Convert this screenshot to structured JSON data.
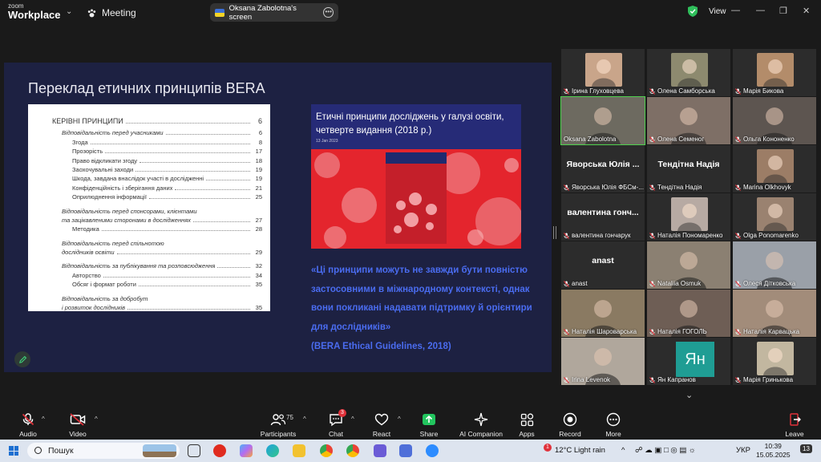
{
  "app": {
    "brand_top": "zoom",
    "brand_main": "Workplace",
    "meeting_label": "Meeting",
    "screen_label": "Oksana Zabolotna's screen",
    "view_label": "View",
    "colors": {
      "background": "#1a1a1a",
      "secure": "#2fbf5b",
      "active_speaker": "#4fd14f",
      "muted": "#e0313a"
    }
  },
  "slide": {
    "title": "Переклад етичних принципів BERA",
    "book_title_line1": "Етичні принципи досліджень у галузі освіти,",
    "book_title_line2": "четверте видання (2018 р.)",
    "book_date": "13 Jan 2023",
    "quote_lines": [
      "«Ці принципи можуть не завжди бути повністю",
      "застосовними в міжнародному контексті, однак",
      "вони покликані надавати підтримку й орієнтири",
      "для дослідників»",
      "(BERA Ethical Guidelines, 2018)"
    ],
    "toc": [
      {
        "text": "КЕРІВНІ ПРИНЦИПИ",
        "page": "6",
        "style": "h1"
      },
      {
        "text": "Відповідальність перед учасниками",
        "page": "6",
        "style": "it ind1"
      },
      {
        "text": "Згода",
        "page": "8",
        "style": "ind2"
      },
      {
        "text": "Прозорість",
        "page": "17",
        "style": "ind2"
      },
      {
        "text": "Право відкликати згоду",
        "page": "18",
        "style": "ind2"
      },
      {
        "text": "Заохочувальні заходи",
        "page": "19",
        "style": "ind2"
      },
      {
        "text": "Шкода, завдана внаслідок участі в дослідженні",
        "page": "19",
        "style": "ind2"
      },
      {
        "text": "Конфіденційність і зберігання даних",
        "page": "21",
        "style": "ind2"
      },
      {
        "text": "Оприлюднення інформації",
        "page": "25",
        "style": "ind2"
      },
      {
        "text": "Відповідальність перед спонсорами, клієнтами",
        "page": "",
        "style": "it ind1 gap nolead"
      },
      {
        "text": "та зацікавленими сторонами в дослідженнях",
        "page": "27",
        "style": "it ind1"
      },
      {
        "text": "Методика",
        "page": "28",
        "style": "ind2"
      },
      {
        "text": "Відповідальність перед спільнотою",
        "page": "",
        "style": "it ind1 gap nolead"
      },
      {
        "text": "дослідників освіти",
        "page": "29",
        "style": "it ind1"
      },
      {
        "text": "Відповідальність за публікування та розповсюдження",
        "page": "32",
        "style": "it ind1 gap"
      },
      {
        "text": "Авторство",
        "page": "34",
        "style": "ind2"
      },
      {
        "text": "Обсяг і формат роботи",
        "page": "35",
        "style": "ind2"
      },
      {
        "text": "Відповідальність за добробут",
        "page": "",
        "style": "it ind1 gap nolead"
      },
      {
        "text": "і розвиток дослідників",
        "page": "35",
        "style": "it ind1"
      }
    ]
  },
  "participants": [
    {
      "name": "Ірина Глуховцева",
      "big": "",
      "kind": "photo",
      "tone": "#c9a58a",
      "muted": true
    },
    {
      "name": "Олена Самборська",
      "big": "",
      "kind": "photo",
      "tone": "#8d8a6f",
      "muted": true
    },
    {
      "name": "Марія Бикова",
      "big": "",
      "kind": "photo",
      "tone": "#b38c6a",
      "muted": true
    },
    {
      "name": "Oksana Zabolotna",
      "big": "",
      "kind": "video",
      "tone": "#6d6a60",
      "muted": false,
      "active": true
    },
    {
      "name": "Олена Семеног",
      "big": "",
      "kind": "video",
      "tone": "#7e6f66",
      "muted": true
    },
    {
      "name": "Ольга Кононенко",
      "big": "",
      "kind": "video",
      "tone": "#5d5550",
      "muted": true
    },
    {
      "name": "Яворська Юлія ФБСм-...",
      "big": "Яворська Юлія ...",
      "kind": "text",
      "tone": "#2c2c2c",
      "muted": true
    },
    {
      "name": "Тендітна Надія",
      "big": "Тендітна Надія",
      "kind": "text",
      "tone": "#2c2c2c",
      "muted": true
    },
    {
      "name": "Marina Olkhovyk",
      "big": "",
      "kind": "photo",
      "tone": "#9c7d66",
      "muted": true
    },
    {
      "name": "валентина гончарук",
      "big": "валентина гонч...",
      "kind": "text",
      "tone": "#2c2c2c",
      "muted": true
    },
    {
      "name": "Наталія Пономаренко",
      "big": "",
      "kind": "photo",
      "tone": "#b7aaa3",
      "muted": true
    },
    {
      "name": "Olga Ponomarenko",
      "big": "",
      "kind": "photo",
      "tone": "#9a8270",
      "muted": true
    },
    {
      "name": "anast",
      "big": "anast",
      "kind": "text",
      "tone": "#2c2c2c",
      "muted": true
    },
    {
      "name": "Nataliia Osmuk",
      "big": "",
      "kind": "video",
      "tone": "#8b8072",
      "muted": true
    },
    {
      "name": "Олеся Дітковська",
      "big": "",
      "kind": "video",
      "tone": "#9aa0a8",
      "muted": true
    },
    {
      "name": "Наталія Шароварська",
      "big": "",
      "kind": "video",
      "tone": "#8a7a62",
      "muted": true
    },
    {
      "name": "Наталія ГОГОЛЬ",
      "big": "",
      "kind": "video",
      "tone": "#6e5e55",
      "muted": true
    },
    {
      "name": "Наталія Карвацька",
      "big": "",
      "kind": "video",
      "tone": "#a28c7a",
      "muted": true
    },
    {
      "name": "Irina Levenok",
      "big": "",
      "kind": "video",
      "tone": "#b0a79c",
      "muted": true
    },
    {
      "name": "Ян Капранов",
      "big": "Ян",
      "kind": "avatar",
      "tone": "#1f9d94",
      "muted": true
    },
    {
      "name": "Марія Гринькова",
      "big": "",
      "kind": "photo",
      "tone": "#c2b7a0",
      "muted": true
    }
  ],
  "toolbar": {
    "audio": "Audio",
    "video": "Video",
    "participants": "Participants",
    "participants_count": "75",
    "chat": "Chat",
    "chat_badge": "3",
    "react": "React",
    "share": "Share",
    "ai_companion": "AI Companion",
    "apps": "Apps",
    "record": "Record",
    "more": "More",
    "leave": "Leave"
  },
  "taskbar": {
    "search_placeholder": "Пошук",
    "weather": "12°C  Light rain",
    "lang": "УКР",
    "time": "10:39",
    "date": "15.05.2025",
    "notif_badge": "13",
    "store_badge": "1"
  }
}
